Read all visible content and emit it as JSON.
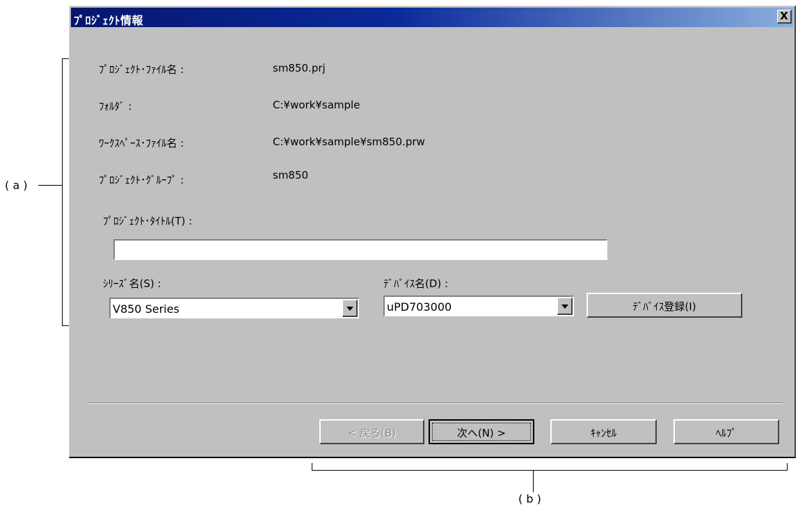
{
  "dialog": {
    "title": "ﾌﾟﾛｼﾞｪｸﾄ情報",
    "close_label": "X"
  },
  "info": {
    "project_file_label": "ﾌﾟﾛｼﾞｪｸﾄ･ﾌｧｲﾙ名 :",
    "project_file_value": "sm850.prj",
    "folder_label": "ﾌｫﾙﾀﾞ :",
    "folder_value": "C:¥work¥sample",
    "workspace_file_label": "ﾜｰｸｽﾍﾟｰｽ･ﾌｧｲﾙ名 :",
    "workspace_file_value": "C:¥work¥sample¥sm850.prw",
    "project_group_label": "ﾌﾟﾛｼﾞｪｸﾄ･ｸﾞﾙｰﾌﾟ :",
    "project_group_value": "sm850"
  },
  "project_title": {
    "label": "ﾌﾟﾛｼﾞｪｸﾄ･ﾀｲﾄﾙ(T) :",
    "value": ""
  },
  "series": {
    "label": "ｼﾘｰｽﾞ名(S) :",
    "selected": "V850 Series"
  },
  "device": {
    "label": "ﾃﾞﾊﾞｲｽ名(D) :",
    "selected": "uPD703000",
    "register_button": "ﾃﾞﾊﾞｲｽ登録(I)"
  },
  "buttons": {
    "back": "< 戻る(B)",
    "next": "次へ(N) >",
    "cancel": "ｷｬﾝｾﾙ",
    "help": "ﾍﾙﾌﾟ"
  },
  "annotations": {
    "a": "( a )",
    "b": "( b )"
  }
}
